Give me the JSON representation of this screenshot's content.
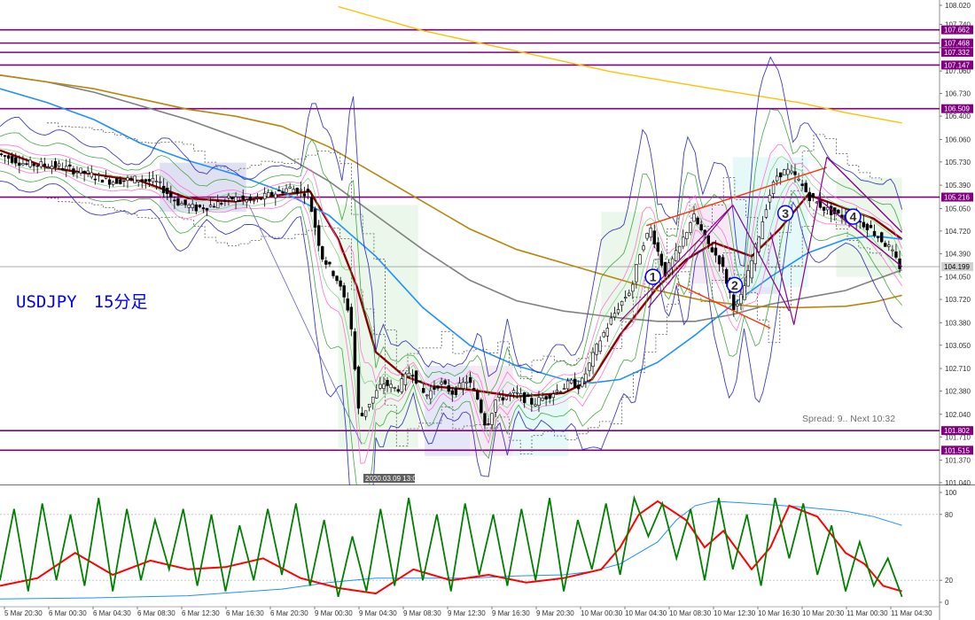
{
  "instrument_label": "USDJPY　15分足",
  "info_text": "Spread: 9.. Next 10:32",
  "current_price": "104.199",
  "cursor_date": "2020.03.09 13:00",
  "colors": {
    "bull_candle": "#000000",
    "hline": "#800080",
    "ma_fast": "#8b0000",
    "ma_blue": "#1e90ff",
    "ma_gray": "#808080",
    "ma_orange": "#b8860b",
    "ma_yellow": "#ffc000",
    "bollinger": "#3030c0",
    "wave_number": "#0000ff",
    "trend_red": "#ff3000",
    "osc_green": "#008000",
    "osc_red": "#ff0000",
    "osc_blue": "#1e90ff"
  },
  "price_axis": [
    {
      "v": 108.02,
      "t": "108.020"
    },
    {
      "v": 107.74,
      "t": "107.740"
    },
    {
      "v": 107.4,
      "t": "107.400"
    },
    {
      "v": 107.06,
      "t": "107.060"
    },
    {
      "v": 106.73,
      "t": "106.730"
    },
    {
      "v": 106.4,
      "t": "106.400"
    },
    {
      "v": 106.06,
      "t": "106.060"
    },
    {
      "v": 105.73,
      "t": "105.730"
    },
    {
      "v": 105.39,
      "t": "105.390"
    },
    {
      "v": 105.05,
      "t": "105.050"
    },
    {
      "v": 104.72,
      "t": "104.720"
    },
    {
      "v": 104.39,
      "t": "104.390"
    },
    {
      "v": 104.05,
      "t": "104.050"
    },
    {
      "v": 103.72,
      "t": "103.720"
    },
    {
      "v": 103.38,
      "t": "103.380"
    },
    {
      "v": 103.05,
      "t": "103.050"
    },
    {
      "v": 102.71,
      "t": "102.710"
    },
    {
      "v": 102.38,
      "t": "102.380"
    },
    {
      "v": 102.04,
      "t": "102.040"
    },
    {
      "v": 101.71,
      "t": "101.710"
    },
    {
      "v": 101.37,
      "t": "101.370"
    },
    {
      "v": 101.04,
      "t": "101.040"
    }
  ],
  "price_lines": [
    {
      "v": 107.662,
      "t": "107.662"
    },
    {
      "v": 107.468,
      "t": "107.468"
    },
    {
      "v": 107.332,
      "t": "107.332"
    },
    {
      "v": 107.147,
      "t": "107.147"
    },
    {
      "v": 106.509,
      "t": "106.509"
    },
    {
      "v": 105.216,
      "t": "105.216"
    },
    {
      "v": 101.802,
      "t": "101.802"
    },
    {
      "v": 101.515,
      "t": "101.515"
    }
  ],
  "osc_axis": [
    {
      "v": 100,
      "t": "100"
    },
    {
      "v": 80,
      "t": "80"
    },
    {
      "v": 20,
      "t": "20"
    },
    {
      "v": 0,
      "t": "0"
    }
  ],
  "time_labels": [
    "5 Mar 20:30",
    "6 Mar 00:30",
    "6 Mar 04:30",
    "6 Mar 08:30",
    "6 Mar 12:30",
    "6 Mar 16:30",
    "6 Mar 20:30",
    "9 Mar 00:30",
    "9 Mar 04:30",
    "9 Mar 08:30",
    "9 Mar 12:30",
    "9 Mar 16:30",
    "9 Mar 20:30",
    "10 Mar 00:30",
    "10 Mar 04:30",
    "10 Mar 08:30",
    "10 Mar 12:30",
    "10 Mar 16:30",
    "10 Mar 20:30",
    "11 Mar 00:30",
    "11 Mar 04:30"
  ],
  "wave_labels": [
    {
      "t": "1",
      "price": 104.05,
      "bar": 0.695
    },
    {
      "t": "2",
      "price": 103.93,
      "bar": 0.782
    },
    {
      "t": "3",
      "price": 104.98,
      "bar": 0.836
    },
    {
      "t": "4",
      "price": 104.93,
      "bar": 0.908
    }
  ],
  "chart_data": {
    "type": "candlestick",
    "ylim": [
      101.04,
      108.02
    ],
    "osc_ylim": [
      0,
      100
    ],
    "close_path": [
      [
        0,
        105.85
      ],
      [
        0.03,
        105.7
      ],
      [
        0.06,
        105.68
      ],
      [
        0.09,
        105.58
      ],
      [
        0.12,
        105.45
      ],
      [
        0.15,
        105.48
      ],
      [
        0.17,
        105.42
      ],
      [
        0.19,
        105.15
      ],
      [
        0.21,
        105.05
      ],
      [
        0.23,
        105.1
      ],
      [
        0.25,
        105.2
      ],
      [
        0.27,
        105.15
      ],
      [
        0.29,
        105.25
      ],
      [
        0.31,
        105.35
      ],
      [
        0.33,
        105.28
      ],
      [
        0.345,
        104.35
      ],
      [
        0.36,
        104.05
      ],
      [
        0.375,
        103.5
      ],
      [
        0.385,
        101.95
      ],
      [
        0.395,
        102.2
      ],
      [
        0.41,
        102.5
      ],
      [
        0.425,
        102.4
      ],
      [
        0.44,
        102.7
      ],
      [
        0.455,
        102.3
      ],
      [
        0.47,
        102.5
      ],
      [
        0.485,
        102.35
      ],
      [
        0.5,
        102.55
      ],
      [
        0.51,
        102.3
      ],
      [
        0.52,
        101.85
      ],
      [
        0.53,
        102.25
      ],
      [
        0.55,
        102.35
      ],
      [
        0.57,
        102.2
      ],
      [
        0.59,
        102.35
      ],
      [
        0.61,
        102.5
      ],
      [
        0.62,
        102.45
      ],
      [
        0.64,
        103.1
      ],
      [
        0.66,
        103.6
      ],
      [
        0.675,
        103.9
      ],
      [
        0.685,
        104.5
      ],
      [
        0.695,
        104.75
      ],
      [
        0.71,
        104.1
      ],
      [
        0.725,
        104.45
      ],
      [
        0.74,
        104.95
      ],
      [
        0.755,
        104.55
      ],
      [
        0.77,
        104.25
      ],
      [
        0.785,
        103.55
      ],
      [
        0.79,
        103.7
      ],
      [
        0.8,
        104.15
      ],
      [
        0.81,
        104.65
      ],
      [
        0.82,
        105.2
      ],
      [
        0.83,
        105.55
      ],
      [
        0.84,
        105.6
      ],
      [
        0.85,
        105.5
      ],
      [
        0.865,
        105.2
      ],
      [
        0.88,
        105.05
      ],
      [
        0.895,
        104.95
      ],
      [
        0.91,
        104.9
      ],
      [
        0.925,
        104.8
      ],
      [
        0.94,
        104.6
      ],
      [
        0.95,
        104.45
      ],
      [
        0.96,
        104.2
      ]
    ],
    "moving_averages": [
      {
        "color": "#8b0000",
        "points": [
          [
            0,
            105.9
          ],
          [
            0.05,
            105.65
          ],
          [
            0.1,
            105.55
          ],
          [
            0.15,
            105.45
          ],
          [
            0.2,
            105.2
          ],
          [
            0.25,
            105.15
          ],
          [
            0.3,
            105.25
          ],
          [
            0.33,
            105.3
          ],
          [
            0.36,
            104.6
          ],
          [
            0.38,
            103.9
          ],
          [
            0.4,
            102.95
          ],
          [
            0.43,
            102.6
          ],
          [
            0.46,
            102.45
          ],
          [
            0.5,
            102.4
          ],
          [
            0.55,
            102.3
          ],
          [
            0.6,
            102.35
          ],
          [
            0.63,
            102.55
          ],
          [
            0.66,
            103.2
          ],
          [
            0.7,
            103.9
          ],
          [
            0.73,
            104.3
          ],
          [
            0.76,
            104.55
          ],
          [
            0.8,
            104.35
          ],
          [
            0.83,
            104.75
          ],
          [
            0.86,
            105.25
          ],
          [
            0.9,
            105.05
          ],
          [
            0.93,
            104.9
          ],
          [
            0.96,
            104.6
          ]
        ]
      },
      {
        "color": "#1e90ff",
        "points": [
          [
            0,
            106.8
          ],
          [
            0.05,
            106.6
          ],
          [
            0.1,
            106.35
          ],
          [
            0.15,
            106.0
          ],
          [
            0.2,
            105.75
          ],
          [
            0.25,
            105.55
          ],
          [
            0.3,
            105.3
          ],
          [
            0.35,
            104.95
          ],
          [
            0.4,
            104.35
          ],
          [
            0.45,
            103.6
          ],
          [
            0.5,
            103.05
          ],
          [
            0.55,
            102.75
          ],
          [
            0.6,
            102.55
          ],
          [
            0.63,
            102.5
          ],
          [
            0.66,
            102.55
          ],
          [
            0.7,
            102.8
          ],
          [
            0.74,
            103.2
          ],
          [
            0.78,
            103.65
          ],
          [
            0.82,
            104.05
          ],
          [
            0.86,
            104.4
          ],
          [
            0.9,
            104.6
          ],
          [
            0.93,
            104.65
          ],
          [
            0.96,
            104.6
          ]
        ]
      },
      {
        "color": "#808080",
        "points": [
          [
            0,
            107.0
          ],
          [
            0.05,
            106.9
          ],
          [
            0.1,
            106.75
          ],
          [
            0.15,
            106.55
          ],
          [
            0.2,
            106.35
          ],
          [
            0.25,
            106.1
          ],
          [
            0.3,
            105.85
          ],
          [
            0.35,
            105.45
          ],
          [
            0.4,
            104.95
          ],
          [
            0.45,
            104.45
          ],
          [
            0.5,
            104.0
          ],
          [
            0.55,
            103.7
          ],
          [
            0.6,
            103.55
          ],
          [
            0.63,
            103.5
          ],
          [
            0.66,
            103.45
          ],
          [
            0.7,
            103.4
          ],
          [
            0.74,
            103.4
          ],
          [
            0.78,
            103.5
          ],
          [
            0.82,
            103.65
          ],
          [
            0.86,
            103.75
          ],
          [
            0.9,
            103.85
          ],
          [
            0.93,
            104.0
          ],
          [
            0.96,
            104.15
          ]
        ]
      },
      {
        "color": "#b8860b",
        "points": [
          [
            0,
            107.0
          ],
          [
            0.05,
            106.9
          ],
          [
            0.1,
            106.8
          ],
          [
            0.15,
            106.65
          ],
          [
            0.2,
            106.5
          ],
          [
            0.25,
            106.4
          ],
          [
            0.3,
            106.25
          ],
          [
            0.35,
            105.95
          ],
          [
            0.4,
            105.55
          ],
          [
            0.45,
            105.15
          ],
          [
            0.5,
            104.75
          ],
          [
            0.55,
            104.45
          ],
          [
            0.6,
            104.25
          ],
          [
            0.65,
            104.05
          ],
          [
            0.7,
            103.85
          ],
          [
            0.75,
            103.7
          ],
          [
            0.8,
            103.62
          ],
          [
            0.85,
            103.6
          ],
          [
            0.9,
            103.62
          ],
          [
            0.93,
            103.68
          ],
          [
            0.96,
            103.78
          ]
        ]
      },
      {
        "color": "#ffc000",
        "points": [
          [
            0.36,
            108.0
          ],
          [
            0.45,
            107.65
          ],
          [
            0.55,
            107.35
          ],
          [
            0.65,
            107.05
          ],
          [
            0.75,
            106.82
          ],
          [
            0.85,
            106.6
          ],
          [
            0.9,
            106.45
          ],
          [
            0.96,
            106.3
          ]
        ]
      }
    ],
    "osc_series": [
      {
        "name": "",
        "color": "#1e90ff",
        "values": [
          [
            0,
            3
          ],
          [
            0.1,
            4
          ],
          [
            0.2,
            6
          ],
          [
            0.3,
            12
          ],
          [
            0.35,
            18
          ],
          [
            0.4,
            22
          ],
          [
            0.5,
            22
          ],
          [
            0.55,
            24
          ],
          [
            0.6,
            25
          ],
          [
            0.63,
            28
          ],
          [
            0.66,
            35
          ],
          [
            0.7,
            55
          ],
          [
            0.72,
            75
          ],
          [
            0.74,
            88
          ],
          [
            0.76,
            92
          ],
          [
            0.8,
            90
          ],
          [
            0.85,
            87
          ],
          [
            0.9,
            83
          ],
          [
            0.93,
            78
          ],
          [
            0.96,
            70
          ]
        ]
      },
      {
        "name": "",
        "color": "#ff0000",
        "values": [
          [
            0,
            15
          ],
          [
            0.04,
            22
          ],
          [
            0.08,
            45
          ],
          [
            0.12,
            25
          ],
          [
            0.16,
            38
          ],
          [
            0.2,
            30
          ],
          [
            0.24,
            32
          ],
          [
            0.28,
            40
          ],
          [
            0.32,
            22
          ],
          [
            0.36,
            13
          ],
          [
            0.4,
            8
          ],
          [
            0.44,
            30
          ],
          [
            0.48,
            20
          ],
          [
            0.52,
            25
          ],
          [
            0.56,
            18
          ],
          [
            0.6,
            22
          ],
          [
            0.64,
            30
          ],
          [
            0.66,
            50
          ],
          [
            0.68,
            80
          ],
          [
            0.7,
            92
          ],
          [
            0.73,
            75
          ],
          [
            0.75,
            50
          ],
          [
            0.77,
            65
          ],
          [
            0.8,
            30
          ],
          [
            0.82,
            50
          ],
          [
            0.84,
            88
          ],
          [
            0.87,
            78
          ],
          [
            0.9,
            45
          ],
          [
            0.92,
            35
          ],
          [
            0.94,
            15
          ],
          [
            0.96,
            10
          ]
        ]
      },
      {
        "name": "",
        "color": "#008000",
        "values": [
          [
            0,
            20
          ],
          [
            0.015,
            85
          ],
          [
            0.03,
            10
          ],
          [
            0.045,
            90
          ],
          [
            0.06,
            20
          ],
          [
            0.075,
            80
          ],
          [
            0.09,
            15
          ],
          [
            0.105,
            95
          ],
          [
            0.12,
            10
          ],
          [
            0.135,
            85
          ],
          [
            0.15,
            20
          ],
          [
            0.165,
            75
          ],
          [
            0.18,
            30
          ],
          [
            0.195,
            85
          ],
          [
            0.21,
            15
          ],
          [
            0.225,
            80
          ],
          [
            0.24,
            10
          ],
          [
            0.255,
            70
          ],
          [
            0.27,
            20
          ],
          [
            0.285,
            85
          ],
          [
            0.3,
            25
          ],
          [
            0.315,
            90
          ],
          [
            0.33,
            15
          ],
          [
            0.345,
            75
          ],
          [
            0.36,
            5
          ],
          [
            0.375,
            60
          ],
          [
            0.39,
            10
          ],
          [
            0.405,
            85
          ],
          [
            0.42,
            15
          ],
          [
            0.435,
            95
          ],
          [
            0.45,
            20
          ],
          [
            0.465,
            80
          ],
          [
            0.48,
            10
          ],
          [
            0.495,
            90
          ],
          [
            0.51,
            25
          ],
          [
            0.525,
            80
          ],
          [
            0.54,
            15
          ],
          [
            0.555,
            85
          ],
          [
            0.57,
            20
          ],
          [
            0.585,
            95
          ],
          [
            0.6,
            10
          ],
          [
            0.615,
            75
          ],
          [
            0.63,
            30
          ],
          [
            0.645,
            90
          ],
          [
            0.66,
            25
          ],
          [
            0.675,
            95
          ],
          [
            0.69,
            60
          ],
          [
            0.705,
            90
          ],
          [
            0.72,
            40
          ],
          [
            0.735,
            85
          ],
          [
            0.75,
            20
          ],
          [
            0.765,
            95
          ],
          [
            0.78,
            30
          ],
          [
            0.795,
            80
          ],
          [
            0.81,
            15
          ],
          [
            0.825,
            95
          ],
          [
            0.84,
            40
          ],
          [
            0.855,
            90
          ],
          [
            0.87,
            25
          ],
          [
            0.885,
            70
          ],
          [
            0.9,
            10
          ],
          [
            0.915,
            55
          ],
          [
            0.93,
            15
          ],
          [
            0.945,
            40
          ],
          [
            0.96,
            5
          ]
        ]
      }
    ]
  }
}
